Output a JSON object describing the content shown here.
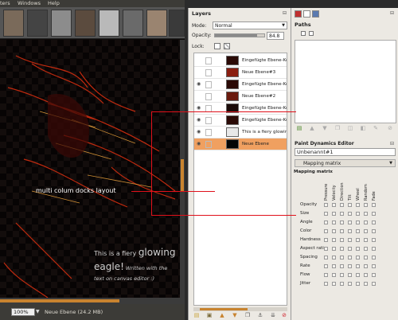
{
  "menubar": {
    "items": [
      "ters",
      "Windows",
      "Help"
    ]
  },
  "canvas": {
    "text_line1_prefix": "This is a fiery",
    "text_line1_big": "glowing",
    "text_line2_big": "eagle!",
    "text_line2_small": "Written with the",
    "text_line3": "text on canvas editor :)"
  },
  "statusbar": {
    "zoom": "100%",
    "status_text": "Neue Ebene (24.2 MB)"
  },
  "layers_dock": {
    "title": "Layers",
    "mode_label": "Mode:",
    "mode_value": "Normal",
    "opacity_label": "Opacity:",
    "opacity_value": "84.8",
    "opacity_fraction": 0.848,
    "lock_label": "Lock:",
    "layers": [
      {
        "name": "Eingefügte Ebene-Kop",
        "visible": false,
        "selected": false
      },
      {
        "name": "Neue Ebene#3",
        "visible": false,
        "selected": false
      },
      {
        "name": "Eingefügte Ebene-Kop",
        "visible": true,
        "selected": false
      },
      {
        "name": "Neue Ebene#2",
        "visible": false,
        "selected": false
      },
      {
        "name": "Eingefügte Ebene-Kop",
        "visible": true,
        "selected": false
      },
      {
        "name": "Eingefügte Ebene-Kop",
        "visible": true,
        "selected": false
      },
      {
        "name": "This is a fiery glowin",
        "visible": true,
        "selected": false
      },
      {
        "name": "Neue Ebene",
        "visible": true,
        "selected": true
      }
    ]
  },
  "paths_dock": {
    "title": "Paths"
  },
  "paint_dynamics": {
    "title": "Paint Dynamics Editor",
    "name_value": "Unbenannt#1",
    "mode_value": "Mapping matrix",
    "matrix_label": "Mapping matrix",
    "columns": [
      "Pressure",
      "Velocity",
      "Direction",
      "Tilt",
      "Wheel",
      "Random",
      "Fade"
    ],
    "rows": [
      "Opacity",
      "Size",
      "Angle",
      "Color",
      "Hardness",
      "Aspect ratio",
      "Spacing",
      "Rate",
      "Flow",
      "Jitter"
    ]
  },
  "annotation": {
    "text": "multi colum docks layout",
    "color": "#e0101a"
  },
  "colors": {
    "accent": "#c8832f",
    "selected_row": "#f0a060",
    "dock_bg": "#ece9e3"
  }
}
